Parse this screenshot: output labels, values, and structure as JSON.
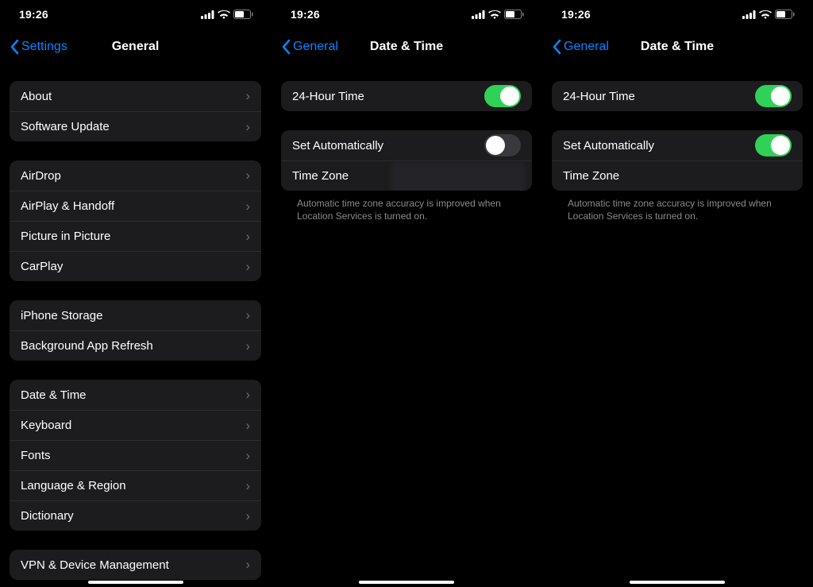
{
  "status": {
    "time": "19:26"
  },
  "screen1": {
    "back": "Settings",
    "title": "General",
    "groups": [
      [
        "About",
        "Software Update"
      ],
      [
        "AirDrop",
        "AirPlay & Handoff",
        "Picture in Picture",
        "CarPlay"
      ],
      [
        "iPhone Storage",
        "Background App Refresh"
      ],
      [
        "Date & Time",
        "Keyboard",
        "Fonts",
        "Language & Region",
        "Dictionary"
      ],
      [
        "VPN & Device Management"
      ]
    ]
  },
  "screen2": {
    "back": "General",
    "title": "Date & Time",
    "row_24h": "24-Hour Time",
    "row_24h_on": true,
    "row_auto": "Set Automatically",
    "row_auto_on": false,
    "row_tz": "Time Zone",
    "footer": "Automatic time zone accuracy is improved when Location Services is turned on."
  },
  "screen3": {
    "back": "General",
    "title": "Date & Time",
    "row_24h": "24-Hour Time",
    "row_24h_on": true,
    "row_auto": "Set Automatically",
    "row_auto_on": true,
    "row_tz": "Time Zone",
    "footer": "Automatic time zone accuracy is improved when Location Services is turned on."
  }
}
